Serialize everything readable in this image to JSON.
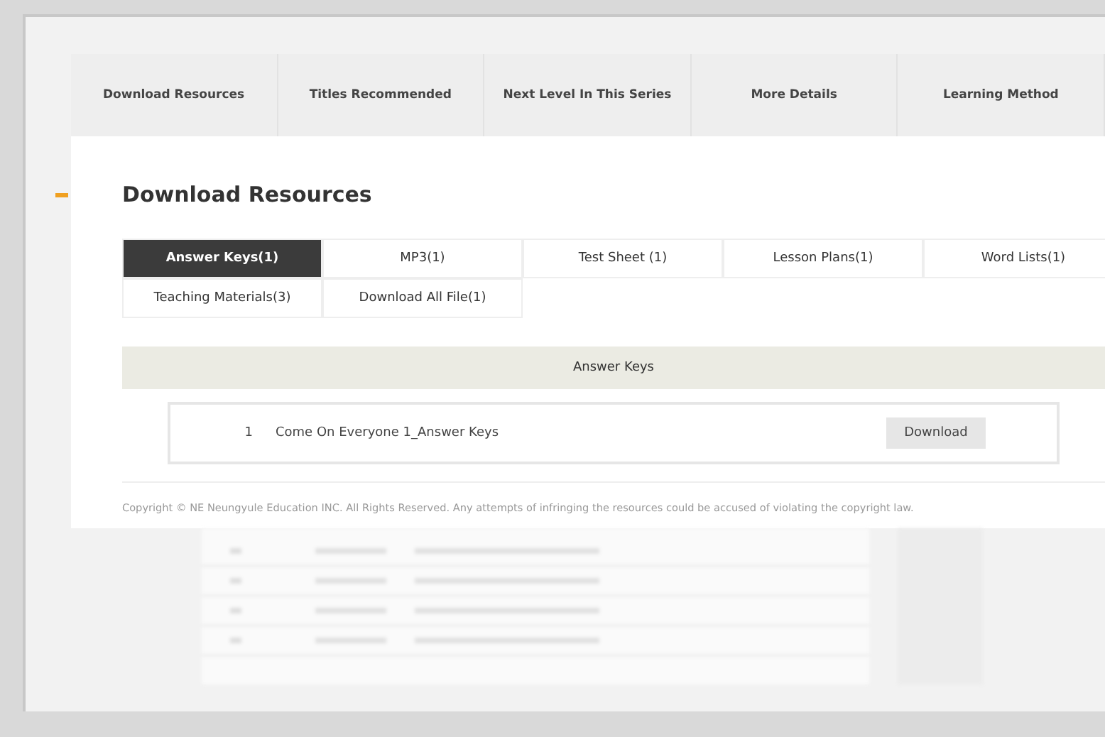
{
  "nav_tabs": [
    {
      "label": "Download Resources"
    },
    {
      "label": "Titles Recommended"
    },
    {
      "label": "Next Level In This Series"
    },
    {
      "label": "More Details"
    },
    {
      "label": "Learning Method"
    }
  ],
  "section_title": "Download Resources",
  "resource_tabs": [
    {
      "label": "Answer Keys(1)",
      "selected": true
    },
    {
      "label": "MP3(1)",
      "selected": false
    },
    {
      "label": "Test Sheet (1)",
      "selected": false
    },
    {
      "label": "Lesson Plans(1)",
      "selected": false
    },
    {
      "label": "Word Lists(1)",
      "selected": false
    },
    {
      "label": "Teaching Materials(3)",
      "selected": false
    },
    {
      "label": "Download All File(1)",
      "selected": false
    }
  ],
  "panel": {
    "title": "Answer Keys",
    "files": [
      {
        "number": "1",
        "name": "Come On Everyone 1_Answer Keys",
        "button": "Download"
      }
    ]
  },
  "copyright": "Copyright © NE Neungyule Education INC. All Rights Reserved. Any attempts of infringing the resources could be accused of violating the copyright law."
}
